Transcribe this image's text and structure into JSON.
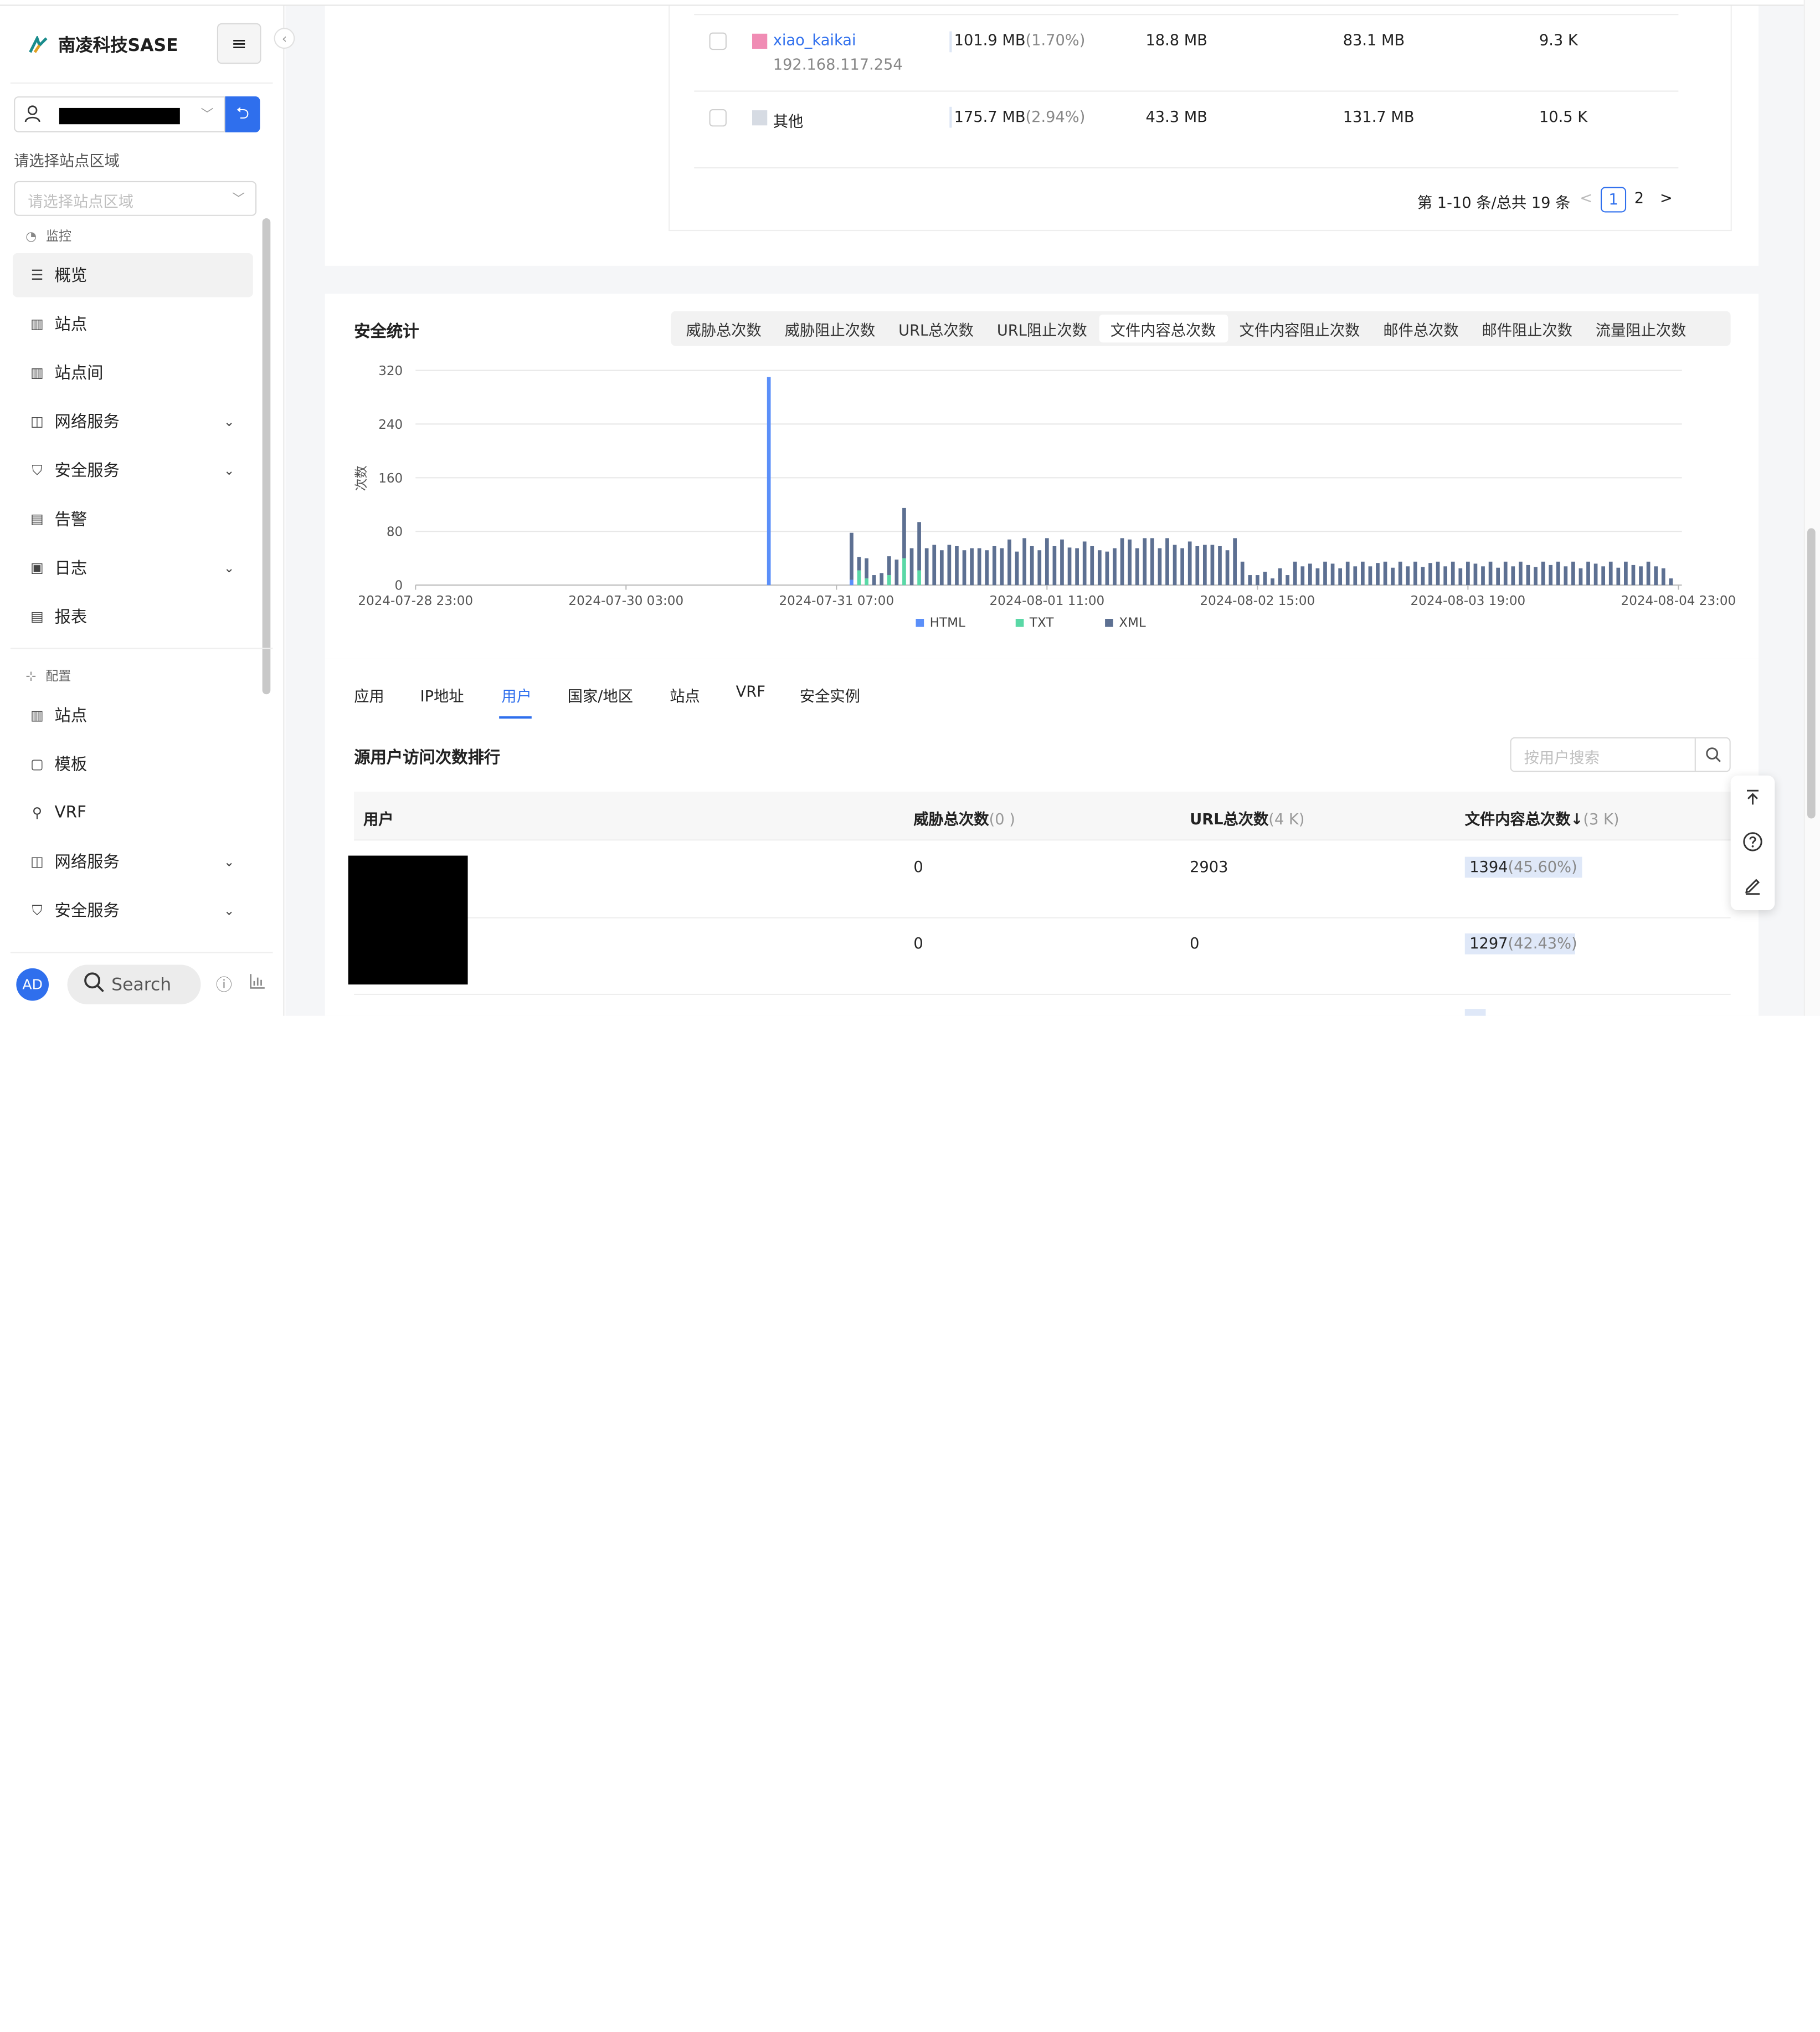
{
  "sidebar": {
    "brand": "南凌科技SASE",
    "site_region_label": "请选择站点区域",
    "site_region_placeholder": "请选择站点区域",
    "group_monitor": "监控",
    "group_config": "配置",
    "monitor_items": [
      {
        "label": "概览",
        "icon": "overview-icon",
        "active": true
      },
      {
        "label": "站点",
        "icon": "building-icon"
      },
      {
        "label": "站点间",
        "icon": "site-link-icon"
      },
      {
        "label": "网络服务",
        "icon": "network-icon",
        "expandable": true
      },
      {
        "label": "安全服务",
        "icon": "shield-icon",
        "expandable": true
      },
      {
        "label": "告警",
        "icon": "alarm-icon"
      },
      {
        "label": "日志",
        "icon": "log-icon",
        "expandable": true
      },
      {
        "label": "报表",
        "icon": "report-icon"
      }
    ],
    "config_items": [
      {
        "label": "站点",
        "icon": "building-icon"
      },
      {
        "label": "模板",
        "icon": "template-icon"
      },
      {
        "label": "VRF",
        "icon": "vrf-icon"
      },
      {
        "label": "网络服务",
        "icon": "network-icon",
        "expandable": true
      },
      {
        "label": "安全服务",
        "icon": "shield-icon",
        "expandable": true
      }
    ],
    "avatar": "AD",
    "search": "Search"
  },
  "traffic_table": {
    "rows": [
      {
        "name": "xiao_kaikai",
        "ip": "192.168.117.254",
        "total": "101.9 MB",
        "pct": "(1.70%)",
        "up": "18.8 MB",
        "down": "83.1 MB",
        "count": "9.3 K",
        "color": "#f08cb4"
      },
      {
        "name": "其他",
        "total": "175.7 MB",
        "pct": "(2.94%)",
        "up": "43.3 MB",
        "down": "131.7 MB",
        "count": "10.5 K",
        "color": "#d6dbe3"
      }
    ],
    "pagination": {
      "summary": "第 1-10 条/总共 19 条",
      "prev": "<",
      "pages": [
        "1",
        "2"
      ],
      "next": ">"
    }
  },
  "security_stats": {
    "title": "安全统计",
    "tabs": [
      "威胁总次数",
      "威胁阻止次数",
      "URL总次数",
      "URL阻止次数",
      "文件内容总次数",
      "文件内容阻止次数",
      "邮件总次数",
      "邮件阻止次数",
      "流量阻止次数"
    ],
    "selected_tab": "文件内容总次数"
  },
  "chart_data": {
    "type": "bar",
    "stacked": true,
    "ylabel": "次数",
    "ylim": [
      0,
      320
    ],
    "yticks": [
      "0",
      "80",
      "160",
      "240",
      "320"
    ],
    "xticks": [
      "2024-07-28 23:00",
      "2024-07-30 03:00",
      "2024-07-31 07:00",
      "2024-08-01 11:00",
      "2024-08-02 15:00",
      "2024-08-03 19:00",
      "2024-08-04 23:00"
    ],
    "x_range_hours": [
      0,
      168
    ],
    "legend_position": "bottom",
    "series": [
      {
        "name": "HTML",
        "color": "#5b8ff9",
        "points": [
          [
            47,
            310
          ],
          [
            58,
            8
          ]
        ]
      },
      {
        "name": "TXT",
        "color": "#5ad8a6",
        "points": [
          [
            59,
            22
          ],
          [
            60,
            10
          ],
          [
            63,
            15
          ],
          [
            65,
            40
          ],
          [
            67,
            22
          ]
        ]
      },
      {
        "name": "XML",
        "color": "#5d7092",
        "points": [
          [
            58,
            70
          ],
          [
            59,
            20
          ],
          [
            60,
            30
          ],
          [
            61,
            15
          ],
          [
            62,
            18
          ],
          [
            63,
            28
          ],
          [
            64,
            38
          ],
          [
            65,
            75
          ],
          [
            66,
            55
          ],
          [
            67,
            72
          ],
          [
            68,
            55
          ],
          [
            69,
            60
          ],
          [
            70,
            52
          ],
          [
            71,
            60
          ],
          [
            72,
            58
          ],
          [
            73,
            52
          ],
          [
            74,
            55
          ],
          [
            75,
            55
          ],
          [
            76,
            52
          ],
          [
            77,
            58
          ],
          [
            78,
            55
          ],
          [
            79,
            68
          ],
          [
            80,
            50
          ],
          [
            81,
            70
          ],
          [
            82,
            58
          ],
          [
            83,
            52
          ],
          [
            84,
            70
          ],
          [
            85,
            58
          ],
          [
            86,
            68
          ],
          [
            87,
            56
          ],
          [
            88,
            55
          ],
          [
            89,
            65
          ],
          [
            90,
            58
          ],
          [
            91,
            52
          ],
          [
            92,
            50
          ],
          [
            93,
            55
          ],
          [
            94,
            70
          ],
          [
            95,
            68
          ],
          [
            96,
            55
          ],
          [
            97,
            70
          ],
          [
            98,
            70
          ],
          [
            99,
            55
          ],
          [
            100,
            70
          ],
          [
            101,
            60
          ],
          [
            102,
            55
          ],
          [
            103,
            65
          ],
          [
            104,
            58
          ],
          [
            105,
            60
          ],
          [
            106,
            60
          ],
          [
            107,
            58
          ],
          [
            108,
            52
          ],
          [
            109,
            70
          ],
          [
            110,
            35
          ],
          [
            111,
            15
          ],
          [
            112,
            15
          ],
          [
            113,
            20
          ],
          [
            114,
            10
          ],
          [
            115,
            25
          ],
          [
            116,
            15
          ],
          [
            117,
            35
          ],
          [
            118,
            28
          ],
          [
            119,
            32
          ],
          [
            120,
            25
          ],
          [
            121,
            35
          ],
          [
            122,
            32
          ],
          [
            123,
            25
          ],
          [
            124,
            35
          ],
          [
            125,
            28
          ],
          [
            126,
            35
          ],
          [
            127,
            28
          ],
          [
            128,
            33
          ],
          [
            129,
            35
          ],
          [
            130,
            26
          ],
          [
            131,
            35
          ],
          [
            132,
            28
          ],
          [
            133,
            35
          ],
          [
            134,
            27
          ],
          [
            135,
            33
          ],
          [
            136,
            35
          ],
          [
            137,
            28
          ],
          [
            138,
            35
          ],
          [
            139,
            25
          ],
          [
            140,
            35
          ],
          [
            141,
            32
          ],
          [
            142,
            28
          ],
          [
            143,
            35
          ],
          [
            144,
            26
          ],
          [
            145,
            35
          ],
          [
            146,
            28
          ],
          [
            147,
            35
          ],
          [
            148,
            30
          ],
          [
            149,
            27
          ],
          [
            150,
            35
          ],
          [
            151,
            30
          ],
          [
            152,
            35
          ],
          [
            153,
            28
          ],
          [
            154,
            35
          ],
          [
            155,
            25
          ],
          [
            156,
            35
          ],
          [
            157,
            32
          ],
          [
            158,
            28
          ],
          [
            159,
            35
          ],
          [
            160,
            26
          ],
          [
            161,
            35
          ],
          [
            162,
            30
          ],
          [
            163,
            28
          ],
          [
            164,
            35
          ],
          [
            165,
            28
          ],
          [
            166,
            25
          ],
          [
            167,
            10
          ]
        ]
      }
    ]
  },
  "ranking": {
    "tabs": [
      "应用",
      "IP地址",
      "用户",
      "国家/地区",
      "站点",
      "VRF",
      "安全实例"
    ],
    "selected_tab": "用户",
    "title": "源用户访问次数排行",
    "search_placeholder": "按用户搜索",
    "columns": [
      {
        "label": "用户",
        "meta": ""
      },
      {
        "label": "威胁总次数",
        "meta": "(0 )"
      },
      {
        "label": "URL总次数",
        "meta": "(4 K)"
      },
      {
        "label": "文件内容总次数↓",
        "meta": "(3 K)"
      }
    ],
    "rows": [
      {
        "threat": "0",
        "url": "2903",
        "file": "1394",
        "file_pct": "(45.60%)"
      },
      {
        "threat": "0",
        "url": "0",
        "file": "1297",
        "file_pct": "(42.43%)"
      }
    ]
  }
}
